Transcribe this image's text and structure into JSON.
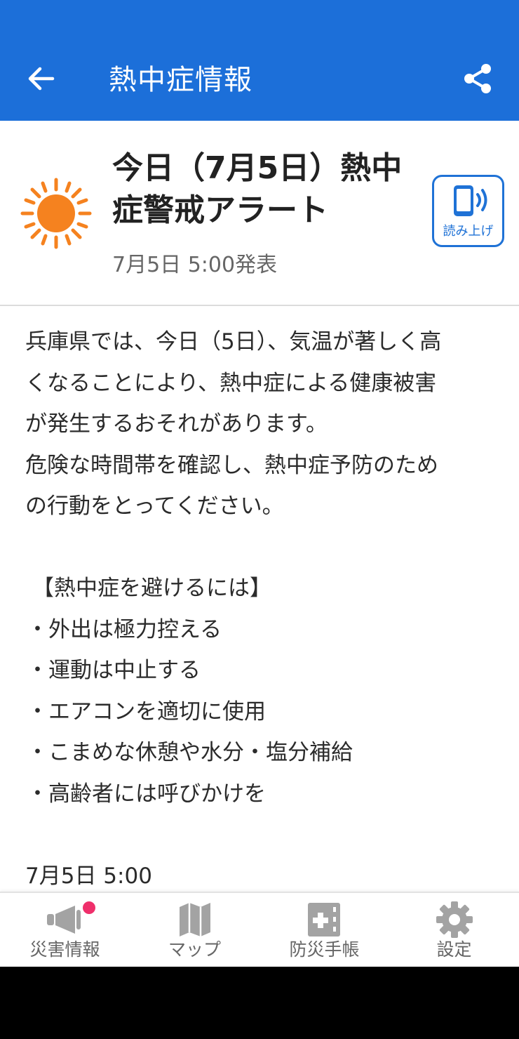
{
  "appbar": {
    "title": "熱中症情報"
  },
  "alert": {
    "title": "今日（7月5日）熱中症警戒アラート",
    "published": "7月5日 5:00発表",
    "read_aloud_label": "読み上げ"
  },
  "body": {
    "lines": [
      "兵庫県では、今日（5日）、気温が著しく高",
      "くなることにより、熱中症による健康被害",
      "が発生するおそれがあります。",
      "危険な時間帯を確認し、熱中症予防のため",
      "の行動をとってください。"
    ],
    "section_heading": "【熱中症を避けるには】",
    "bullets": [
      "・外出は極力控える",
      "・運動は中止する",
      "・エアコンを適切に使用",
      "・こまめな休憩や水分・塩分補給",
      "・高齢者には呼びかけを"
    ],
    "footer_time": "7月5日 5:00"
  },
  "nav": {
    "items": [
      {
        "label": "災害情報",
        "icon": "megaphone-icon",
        "has_badge": true
      },
      {
        "label": "マップ",
        "icon": "map-icon"
      },
      {
        "label": "防災手帳",
        "icon": "handbook-icon"
      },
      {
        "label": "設定",
        "icon": "gear-icon"
      }
    ]
  },
  "colors": {
    "appbar": "#1c6fd9",
    "accent": "#1f72d6",
    "sun": "#f5821f",
    "badge": "#ef2f6b",
    "nav_icon": "#9a9a9a"
  }
}
